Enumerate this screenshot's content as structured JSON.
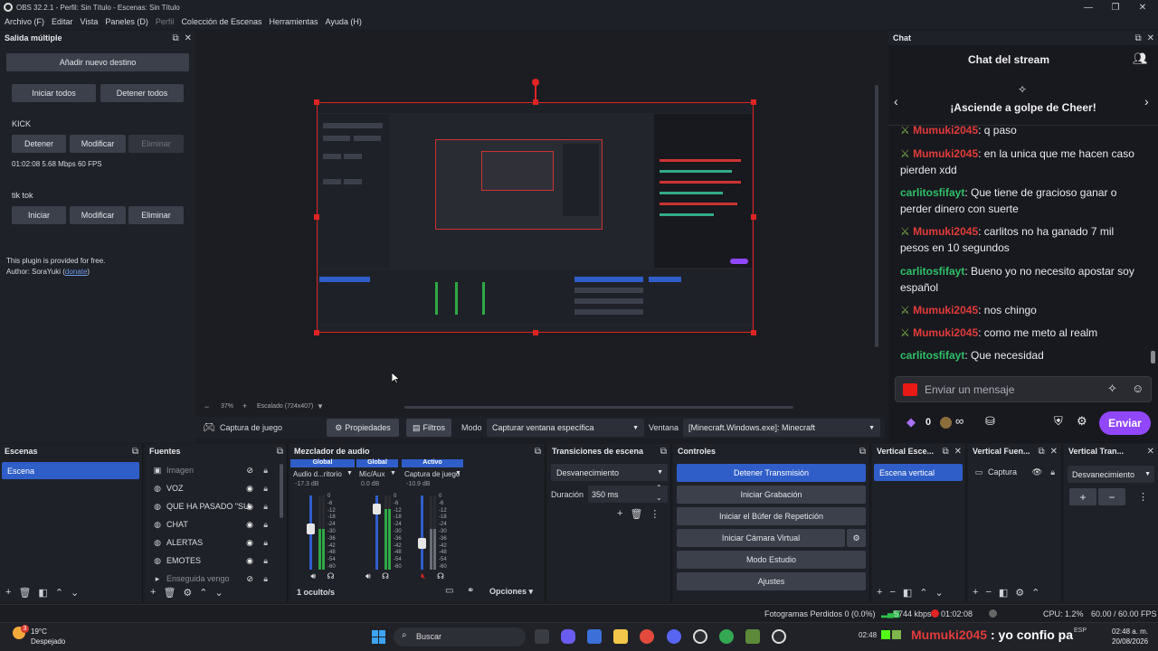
{
  "window": {
    "title": "OBS 32.2.1 - Perfil: Sin Título - Escenas: Sin Título"
  },
  "menu": [
    {
      "label": "Archivo (F)",
      "dim": false
    },
    {
      "label": "Editar",
      "dim": false
    },
    {
      "label": "Vista",
      "dim": false
    },
    {
      "label": "Paneles (D)",
      "dim": false
    },
    {
      "label": "Perfil",
      "dim": true
    },
    {
      "label": "Colección de Escenas",
      "dim": false
    },
    {
      "label": "Herramientas",
      "dim": false
    },
    {
      "label": "Ayuda (H)",
      "dim": false
    }
  ],
  "multi_output": {
    "title": "Salida múltiple",
    "add_destination": "Añadir nuevo destino",
    "start_all": "Iniciar todos",
    "stop_all": "Detener todos",
    "targets": [
      {
        "name": "KICK",
        "primary": "Detener",
        "modify": "Modificar",
        "remove": "Eliminar",
        "stats": "01:02:08  5.68 Mbps  60 FPS"
      },
      {
        "name": "tik tok",
        "primary": "Iniciar",
        "modify": "Modificar",
        "remove": "Eliminar"
      }
    ],
    "plugin_note": "This plugin is provided for free.",
    "author_prefix": "Author: SoraYuki (",
    "donate": "donate",
    "author_suffix": ")"
  },
  "preview": {
    "zoom_minus": "−",
    "zoom": "37%",
    "zoom_plus": "+",
    "scale": "Escalado (724x407)"
  },
  "source_toolbar": {
    "source_name": "Captura de juego",
    "properties": "Propiedades",
    "filters": "Filtros",
    "mode_label": "Modo",
    "mode_value": "Capturar ventana específica",
    "window_label": "Ventana",
    "window_value": "[Minecraft.Windows.exe]: Minecraft"
  },
  "chat": {
    "dock_title": "Chat",
    "header": "Chat del stream",
    "cheer_banner": "¡Asciende a golpe de Cheer!",
    "messages": [
      {
        "user": "Mumuki2045",
        "text": ": q paso",
        "badge": true,
        "color": "red"
      },
      {
        "user": "Mumuki2045",
        "text": ": en la unica que me hacen caso pierden xdd",
        "badge": true,
        "color": "red"
      },
      {
        "user": "carlitosfifayt",
        "text": ": Que tiene de gracioso ganar o perder dinero con suerte",
        "badge": false,
        "color": "green"
      },
      {
        "user": "Mumuki2045",
        "text": ": carlitos no ha ganado 7 mil pesos en 10 segundos",
        "badge": true,
        "color": "red"
      },
      {
        "user": "carlitosfifayt",
        "text": ": Bueno yo no necesito apostar soy español",
        "badge": false,
        "color": "green"
      },
      {
        "user": "Mumuki2045",
        "text": ": nos chingo",
        "badge": true,
        "color": "red"
      },
      {
        "user": "Mumuki2045",
        "text": ": como me meto al realm",
        "badge": true,
        "color": "red"
      },
      {
        "user": "carlitosfifayt",
        "text": ": Que necesidad",
        "badge": false,
        "color": "green"
      }
    ],
    "input_placeholder": "Enviar un mensaje",
    "points": "0",
    "send": "Enviar"
  },
  "scenes": {
    "title": "Escenas",
    "items": [
      "Escena"
    ]
  },
  "sources": {
    "title": "Fuentes",
    "items": [
      {
        "name": "Imagen",
        "icon": "image-icon",
        "visible": false
      },
      {
        "name": "VOZ",
        "icon": "browser-icon",
        "visible": true
      },
      {
        "name": "QUE HA PASADO \"SUB",
        "icon": "browser-icon",
        "visible": true
      },
      {
        "name": "CHAT",
        "icon": "browser-icon",
        "visible": true
      },
      {
        "name": "ALERTAS",
        "icon": "browser-icon",
        "visible": true
      },
      {
        "name": "EMOTES",
        "icon": "browser-icon",
        "visible": true
      },
      {
        "name": "Enseguida vengo",
        "icon": "group-icon",
        "visible": false
      }
    ]
  },
  "mixer": {
    "title": "Mezclador de audio",
    "channels": [
      {
        "tag": "Global",
        "name": "Audio d...ritorio",
        "db": "-17.3 dB",
        "level": 0.55,
        "muted": false
      },
      {
        "tag": "Global",
        "name": "Mic/Aux",
        "db": "0.0 dB",
        "level": 0.82,
        "muted": false
      },
      {
        "tag": "Activo",
        "name": "Captura de juego",
        "db": "-10.9 dB",
        "level": 0.35,
        "muted": true
      }
    ],
    "scale": [
      "0",
      "-6",
      "-12",
      "-18",
      "-24",
      "-30",
      "-36",
      "-42",
      "-48",
      "-54",
      "-60"
    ],
    "hidden": "1 oculto/s",
    "options": "Opciones"
  },
  "transitions": {
    "title": "Transiciones de escena",
    "selected": "Desvanecimiento",
    "duration_label": "Duración",
    "duration_value": "350 ms"
  },
  "controls": {
    "title": "Controles",
    "stop_stream": "Detener Transmisión",
    "start_recording": "Iniciar Grabación",
    "replay_buffer": "Iniciar el Búfer de Repetición",
    "virtual_camera": "Iniciar Cámara Virtual",
    "studio_mode": "Modo Estudio",
    "settings": "Ajustes"
  },
  "vertical_scenes": {
    "title": "Vertical Esce...",
    "items": [
      "Escena vertical"
    ]
  },
  "vertical_sources": {
    "title": "Vertical Fuen...",
    "items": [
      "Captura"
    ]
  },
  "vertical_transitions": {
    "title": "Vertical Tran...",
    "selected": "Desvanecimiento"
  },
  "status": {
    "dropped": "Fotogramas Perdidos 0 (0.0%)",
    "kbps": "5744 kbps",
    "time": "01:02:08",
    "cpu": "CPU: 1.2%",
    "fps": "60.00 / 60.00 FPS"
  },
  "taskbar": {
    "temp": "19°C",
    "weather": "Despejado",
    "weather_badge": "3",
    "search": "Buscar",
    "ticker_time": "02:48",
    "ticker_user": "Mumuki2045",
    "ticker_text": ": yo confio pa",
    "lang": "ESP",
    "clock": "02:48 a. m.",
    "date": "20/08/2026"
  }
}
